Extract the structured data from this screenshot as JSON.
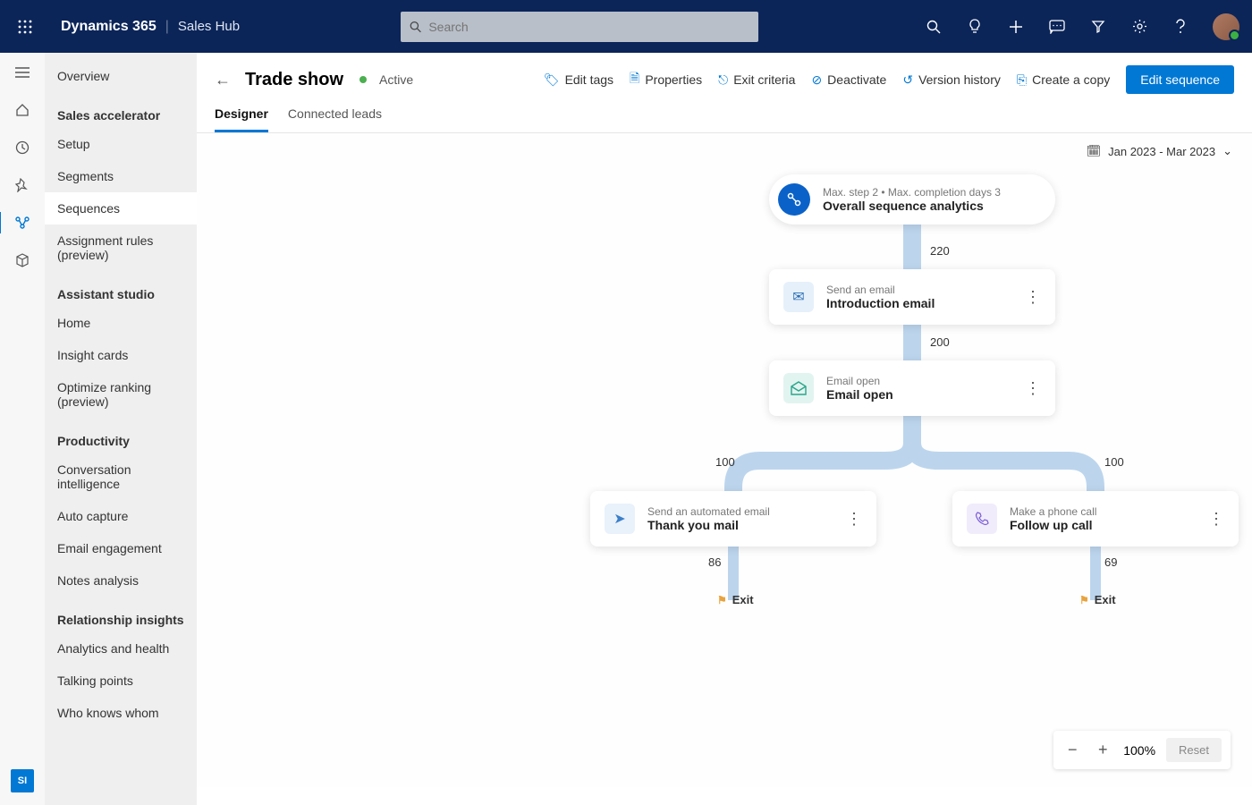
{
  "topnav": {
    "brand": "Dynamics 365",
    "sub": "Sales Hub",
    "search_placeholder": "Search"
  },
  "rail": {
    "si_badge": "SI"
  },
  "sidenav": {
    "overview": "Overview",
    "section1": "Sales accelerator",
    "s1_items": [
      "Setup",
      "Segments",
      "Sequences",
      "Assignment rules (preview)"
    ],
    "section2": "Assistant studio",
    "s2_items": [
      "Home",
      "Insight cards",
      "Optimize ranking (preview)"
    ],
    "section3": "Productivity",
    "s3_items": [
      "Conversation intelligence",
      "Auto capture",
      "Email engagement",
      "Notes analysis"
    ],
    "section4": "Relationship insights",
    "s4_items": [
      "Analytics and health",
      "Talking points",
      "Who knows whom"
    ]
  },
  "header": {
    "title": "Trade show",
    "status": "Active",
    "actions": [
      "Edit tags",
      "Properties",
      "Exit criteria",
      "Deactivate",
      "Version history",
      "Create a copy"
    ],
    "primary": "Edit sequence"
  },
  "tabs": {
    "designer": "Designer",
    "connected": "Connected leads"
  },
  "date_range": "Jan 2023 - Mar 2023",
  "flow": {
    "root": {
      "kicker": "Max. step 2 • Max. completion days 3",
      "title": "Overall sequence analytics"
    },
    "edge1": "220",
    "step1": {
      "kicker": "Send an email",
      "title": "Introduction email"
    },
    "edge2": "200",
    "step2": {
      "kicker": "Email open",
      "title": "Email open"
    },
    "edgeL": "100",
    "edgeR": "100",
    "branchL": {
      "kicker": "Send an automated email",
      "title": "Thank you mail"
    },
    "branchR": {
      "kicker": "Make a phone call",
      "title": "Follow up call"
    },
    "exitL_count": "86",
    "exitR_count": "69",
    "exit_label": "Exit"
  },
  "zoom": {
    "level": "100%",
    "reset": "Reset"
  }
}
